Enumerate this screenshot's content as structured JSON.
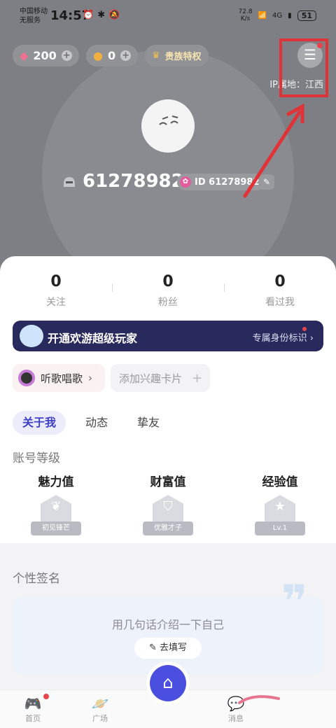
{
  "status": {
    "carrier1": "中国移动",
    "carrier2": "无服务",
    "time": "14:57",
    "speed_value": "72.8",
    "speed_unit": "K/s",
    "network": "4G",
    "battery": "51"
  },
  "currency": {
    "gems": "200",
    "beans": "0",
    "vip_label": "贵族特权"
  },
  "ip_location": "IP属地：江西",
  "profile": {
    "username": "61278982",
    "id_label": "ID 61278982"
  },
  "stats": [
    {
      "value": "0",
      "label": "关注"
    },
    {
      "value": "0",
      "label": "粉丝"
    },
    {
      "value": "0",
      "label": "看过我"
    }
  ],
  "vip_banner": {
    "title": "开通欢游超级玩家",
    "link": "专属身份标识"
  },
  "tags": {
    "music": "听歌唱歌",
    "add_label": "添加兴趣卡片"
  },
  "tabs": [
    "关于我",
    "动态",
    "挚友"
  ],
  "account_level": {
    "title": "账号等级",
    "items": [
      {
        "name": "魅力值",
        "badge": "初见锋芒"
      },
      {
        "name": "财富值",
        "badge": "优雅才子"
      },
      {
        "name": "经验值",
        "badge": "Lv.1"
      }
    ]
  },
  "signature": {
    "title": "个性签名",
    "placeholder": "用几句话介绍一下自己",
    "button": "去填写"
  },
  "nav": {
    "home": "首页",
    "square": "广场",
    "messages": "消息"
  },
  "colors": {
    "accent": "#4a4fe0",
    "annotation_red": "#e03338",
    "vip_bg": "#28295c"
  }
}
